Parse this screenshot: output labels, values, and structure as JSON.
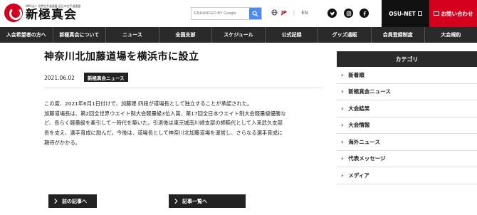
{
  "header": {
    "logo_sub": "NPO法人 世界空手道連盟 全日本空手道連盟",
    "logo_name": "新極真会",
    "search_placeholder": "ENHANCED BY Google",
    "lang_jp": "JP",
    "lang_sep": "|",
    "lang_en": "EN",
    "social_icons": [
      "twitter-icon",
      "instagram-icon",
      "facebook-icon"
    ],
    "osu_net_label": "OSU-NET",
    "contact_label": "お問い合わせ"
  },
  "nav": {
    "items": [
      "入会希望者の方へ",
      "新極真会について",
      "ニュース",
      "全国支部",
      "スケジュール",
      "公式記録",
      "グッズ通販",
      "会員登録制度",
      "大会規約"
    ]
  },
  "article": {
    "title": "神奈川北加藤道場を横浜市に設立",
    "date": "2021.06.02",
    "tag": "新極真会ニュース",
    "lines": [
      "この度、2021年6月1日付けで、加藤建 四段が道場長として独立することが承認された。",
      "加藤道場長は、第2回全世界ウエイト制大会軽量級3位入賞、第17回全日本ウエイト制大会軽量級優勝な",
      "ど、長らく軽量級を牽引して一時代を築いた。引退後は東京城南川崎支部の師範代として入来武久支部",
      "長を支え、選手育成に励んだ。今後は、道場長として神奈川北加藤道場を運営し、さらなる選手育成に",
      "期待がかかる。"
    ],
    "prev_label": "前の記事へ",
    "list_label": "記事一覧へ"
  },
  "sidebar": {
    "heading": "カテゴリ",
    "items": [
      "新着順",
      "新極真会ニュース",
      "大会結果",
      "大会情報",
      "海外ニュース",
      "代表メッセージ",
      "メディア"
    ]
  },
  "colors": {
    "brand_red": "#d4001e",
    "dark": "#2a2a2a",
    "search_blue": "#4a8af4"
  }
}
